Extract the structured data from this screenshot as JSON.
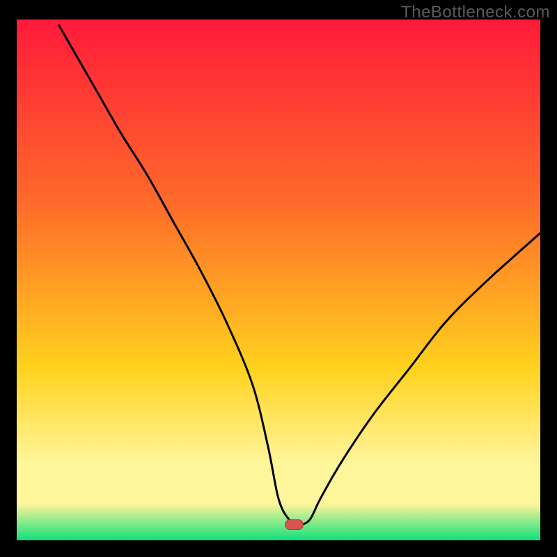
{
  "watermark": "TheBottleneck.com",
  "colors": {
    "bg": "#000000",
    "curve": "#000000",
    "marker_fill": "#d9544f",
    "marker_stroke": "#a83a36",
    "grad_top": "#ff1a3a",
    "grad_mid1": "#ff6a2a",
    "grad_mid2": "#ffd21e",
    "grad_mid3": "#fff59a",
    "grad_bottom": "#11e07a"
  },
  "chart_data": {
    "type": "line",
    "title": "",
    "xlabel": "",
    "ylabel": "",
    "xlim": [
      0,
      100
    ],
    "ylim": [
      0,
      100
    ],
    "marker": {
      "x": 53,
      "y": 3
    },
    "series": [
      {
        "name": "bottleneck-curve",
        "x": [
          8,
          12,
          16,
          20,
          25,
          30,
          35,
          40,
          45,
          48,
          50,
          52,
          54,
          56,
          58,
          62,
          68,
          75,
          82,
          90,
          100
        ],
        "values": [
          99,
          92,
          85,
          78,
          70,
          61,
          52,
          42,
          30,
          18,
          8,
          4,
          3,
          4,
          8,
          15,
          24,
          33,
          42,
          50,
          59
        ]
      }
    ]
  }
}
